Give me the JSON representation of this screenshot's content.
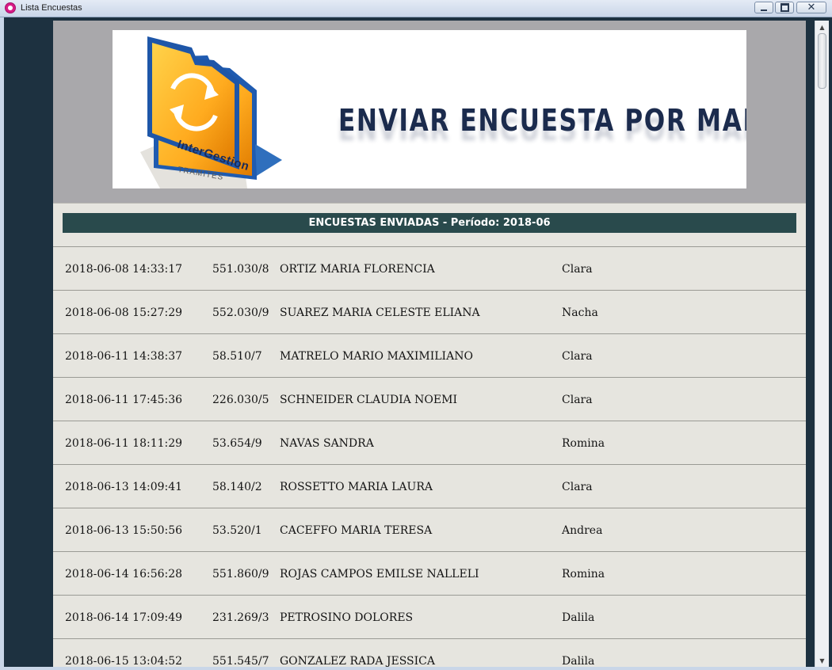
{
  "window": {
    "title": "Lista Encuestas",
    "close_glyph": "✕"
  },
  "banner": {
    "title": "ENVIAR ENCUESTA POR MAIL",
    "logo_text": "InterGestion",
    "logo_subtext": "TRAMITES"
  },
  "header": {
    "period_title": "ENCUESTAS ENVIADAS - Período: 2018-06"
  },
  "rows": [
    {
      "datetime": "2018-06-08 14:33:17",
      "id": "551.030/8",
      "name": "ORTIZ MARIA FLORENCIA",
      "user": "Clara"
    },
    {
      "datetime": "2018-06-08 15:27:29",
      "id": "552.030/9",
      "name": "SUAREZ MARIA CELESTE ELIANA",
      "user": "Nacha"
    },
    {
      "datetime": "2018-06-11 14:38:37",
      "id": "58.510/7",
      "name": "MATRELO MARIO MAXIMILIANO",
      "user": "Clara"
    },
    {
      "datetime": "2018-06-11 17:45:36",
      "id": "226.030/5",
      "name": "SCHNEIDER CLAUDIA NOEMI",
      "user": "Clara"
    },
    {
      "datetime": "2018-06-11 18:11:29",
      "id": "53.654/9",
      "name": "NAVAS SANDRA",
      "user": "Romina"
    },
    {
      "datetime": "2018-06-13 14:09:41",
      "id": "58.140/2",
      "name": "ROSSETTO MARIA LAURA",
      "user": "Clara"
    },
    {
      "datetime": "2018-06-13 15:50:56",
      "id": "53.520/1",
      "name": "CACEFFO MARIA TERESA",
      "user": "Andrea"
    },
    {
      "datetime": "2018-06-14 16:56:28",
      "id": "551.860/9",
      "name": "ROJAS CAMPOS EMILSE NALLELI",
      "user": "Romina"
    },
    {
      "datetime": "2018-06-14 17:09:49",
      "id": "231.269/3",
      "name": "PETROSINO DOLORES",
      "user": "Dalila"
    },
    {
      "datetime": "2018-06-15 13:04:52",
      "id": "551.545/7",
      "name": "GONZALEZ RADA JESSICA",
      "user": "Dalila"
    }
  ],
  "icons": {
    "app": "app-icon",
    "minimize": "minimize-icon",
    "maximize": "maximize-icon",
    "close": "close-icon",
    "scroll_up": "arrow-up-icon",
    "scroll_down": "arrow-down-icon"
  },
  "colors": {
    "sidebar": "#1d3140",
    "header_bar": "#294a4c",
    "content_bg": "#e6e5df",
    "banner_bg": "#a9a8ab"
  }
}
